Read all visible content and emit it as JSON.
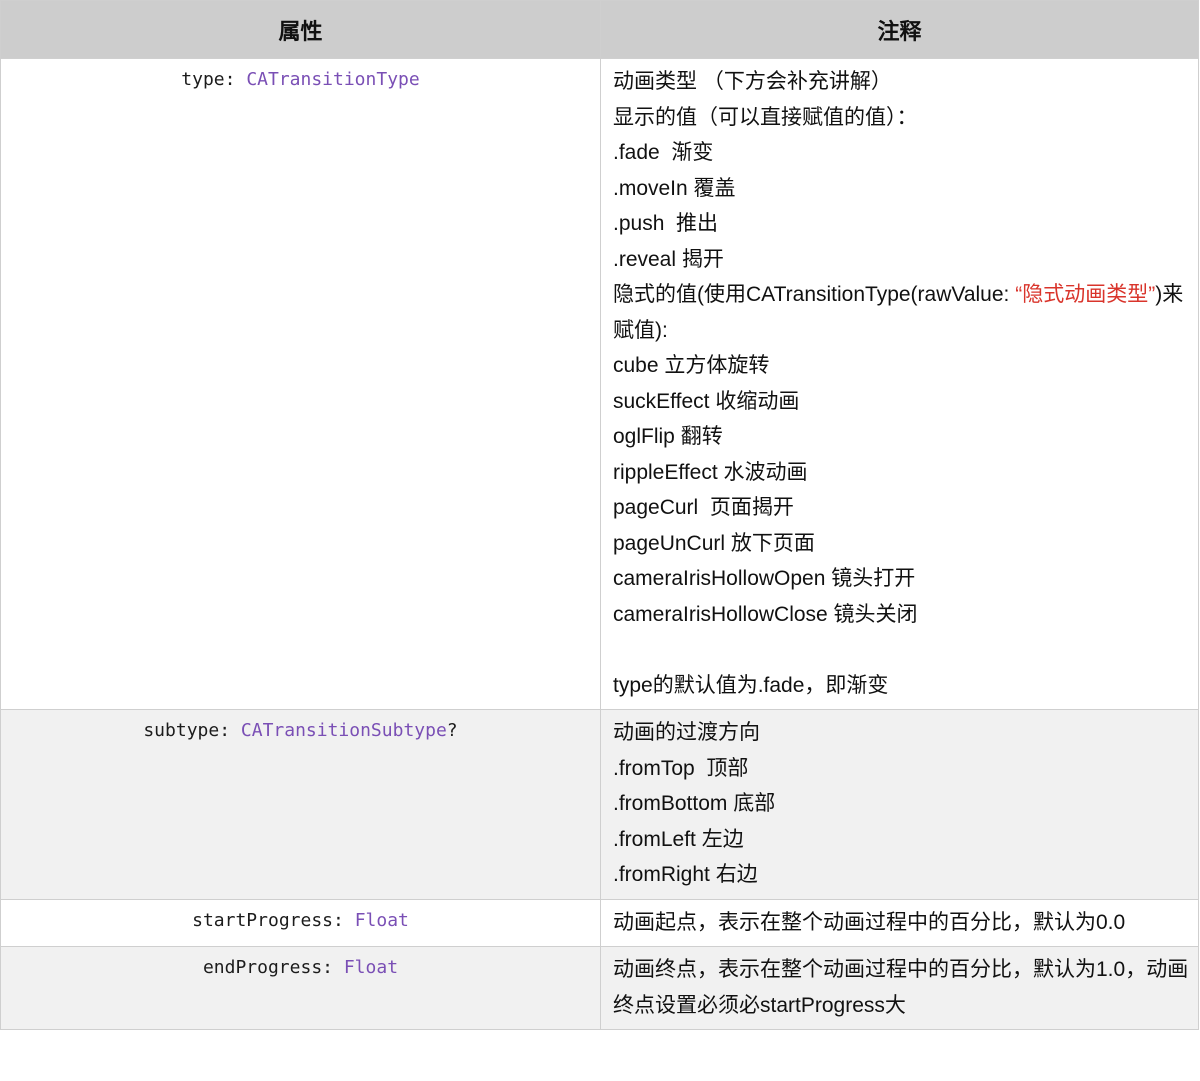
{
  "header": {
    "col_property": "属性",
    "col_note": "注释"
  },
  "rows": [
    {
      "prop_name": "type: ",
      "prop_type": "CATransitionType",
      "prop_suffix": "",
      "note": {
        "l1": "动画类型 （下方会补充讲解）",
        "l2": "显示的值（可以直接赋值的值）：",
        "l3": ".fade  渐变",
        "l4": ".moveIn 覆盖",
        "l5": ".push  推出",
        "l6": ".reveal 揭开",
        "l7_pre": "隐式的值(使用CATransitionType(rawValue: ",
        "l7_quote": "“隐式动画类型”",
        "l7_post": ")来赋值):",
        "l8": "cube 立方体旋转",
        "l9": "suckEffect 收缩动画",
        "l10": "oglFlip 翻转",
        "l11": "rippleEffect 水波动画",
        "l12": "pageCurl  页面揭开",
        "l13": "pageUnCurl 放下页面",
        "l14": "cameraIrisHollowOpen 镜头打开",
        "l15": "cameraIrisHollowClose 镜头关闭",
        "l16": "type的默认值为.fade，即渐变"
      }
    },
    {
      "prop_name": "subtype: ",
      "prop_type": "CATransitionSubtype",
      "prop_suffix": "?",
      "note": {
        "l1": "动画的过渡方向",
        "l2": ".fromTop  顶部",
        "l3": ".fromBottom 底部",
        "l4": ".fromLeft 左边",
        "l5": ".fromRight 右边"
      }
    },
    {
      "prop_name": "startProgress: ",
      "prop_type": "Float",
      "prop_suffix": "",
      "note": {
        "l1": "动画起点，表示在整个动画过程中的百分比，默认为0.0"
      }
    },
    {
      "prop_name": "endProgress: ",
      "prop_type": "Float",
      "prop_suffix": "",
      "note": {
        "l1": "动画终点，表示在整个动画过程中的百分比，默认为1.0，动画终点设置必须必startProgress大"
      }
    }
  ],
  "colors": {
    "header_bg": "#cdcdcd",
    "type_color": "#7a4fb5",
    "quote_color": "#d9342b",
    "shaded_row_bg": "#f1f1f1"
  }
}
